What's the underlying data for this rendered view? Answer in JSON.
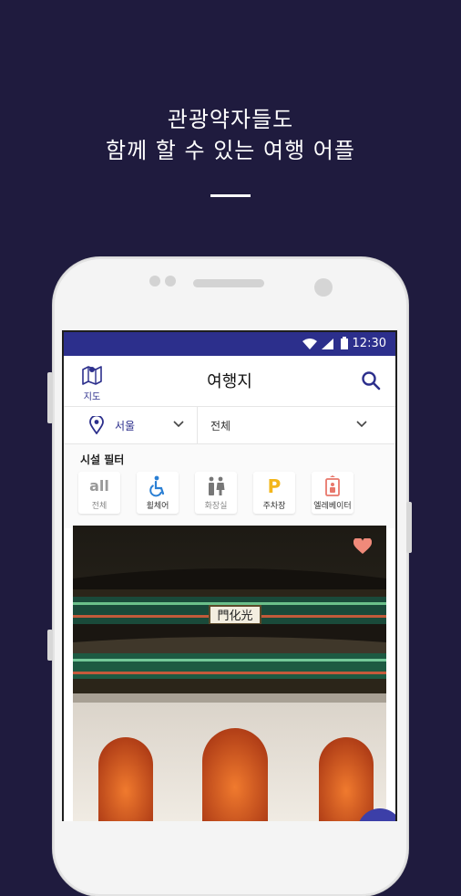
{
  "headline": {
    "line1": "관광약자들도",
    "line2": "함께 할 수 있는 여행 어플"
  },
  "statusbar": {
    "time": "12:30"
  },
  "appbar": {
    "map_label": "지도",
    "title": "여행지"
  },
  "filters": {
    "region_value": "서울",
    "category_value": "전체"
  },
  "facility_filter": {
    "header": "시설 필터",
    "items": [
      {
        "icon_text": "all",
        "label": "전체"
      },
      {
        "label": "휠체어"
      },
      {
        "label": "화장실"
      },
      {
        "icon_text": "P",
        "label": "주차장"
      },
      {
        "label": "엘레베이터"
      }
    ]
  },
  "card": {
    "sign_text": "門化光"
  },
  "colors": {
    "background": "#1f1b3e",
    "brand": "#2c2f8c",
    "heart": "#f08a7a",
    "parking": "#f3b61c"
  }
}
